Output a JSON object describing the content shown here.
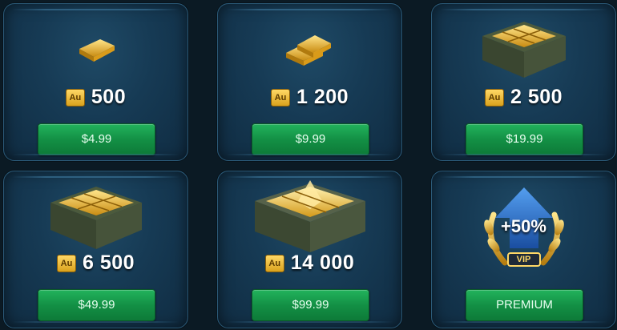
{
  "currency_badge": "Au",
  "packs": [
    {
      "amount": "500",
      "price": "$4.99",
      "art": "gold-bar-icon"
    },
    {
      "amount": "1 200",
      "price": "$9.99",
      "art": "gold-bars-icon"
    },
    {
      "amount": "2 500",
      "price": "$19.99",
      "art": "gold-crate-icon"
    },
    {
      "amount": "6 500",
      "price": "$49.99",
      "art": "gold-crate-large-icon"
    },
    {
      "amount": "14 000",
      "price": "$99.99",
      "art": "gold-chest-icon"
    }
  ],
  "premium": {
    "bonus": "+50%",
    "badge": "VIP",
    "button": "PREMIUM",
    "art": "vip-laurel-icon"
  },
  "colors": {
    "gold": "#f2c230",
    "button_green": "#139045",
    "card_blue": "#163a54"
  }
}
